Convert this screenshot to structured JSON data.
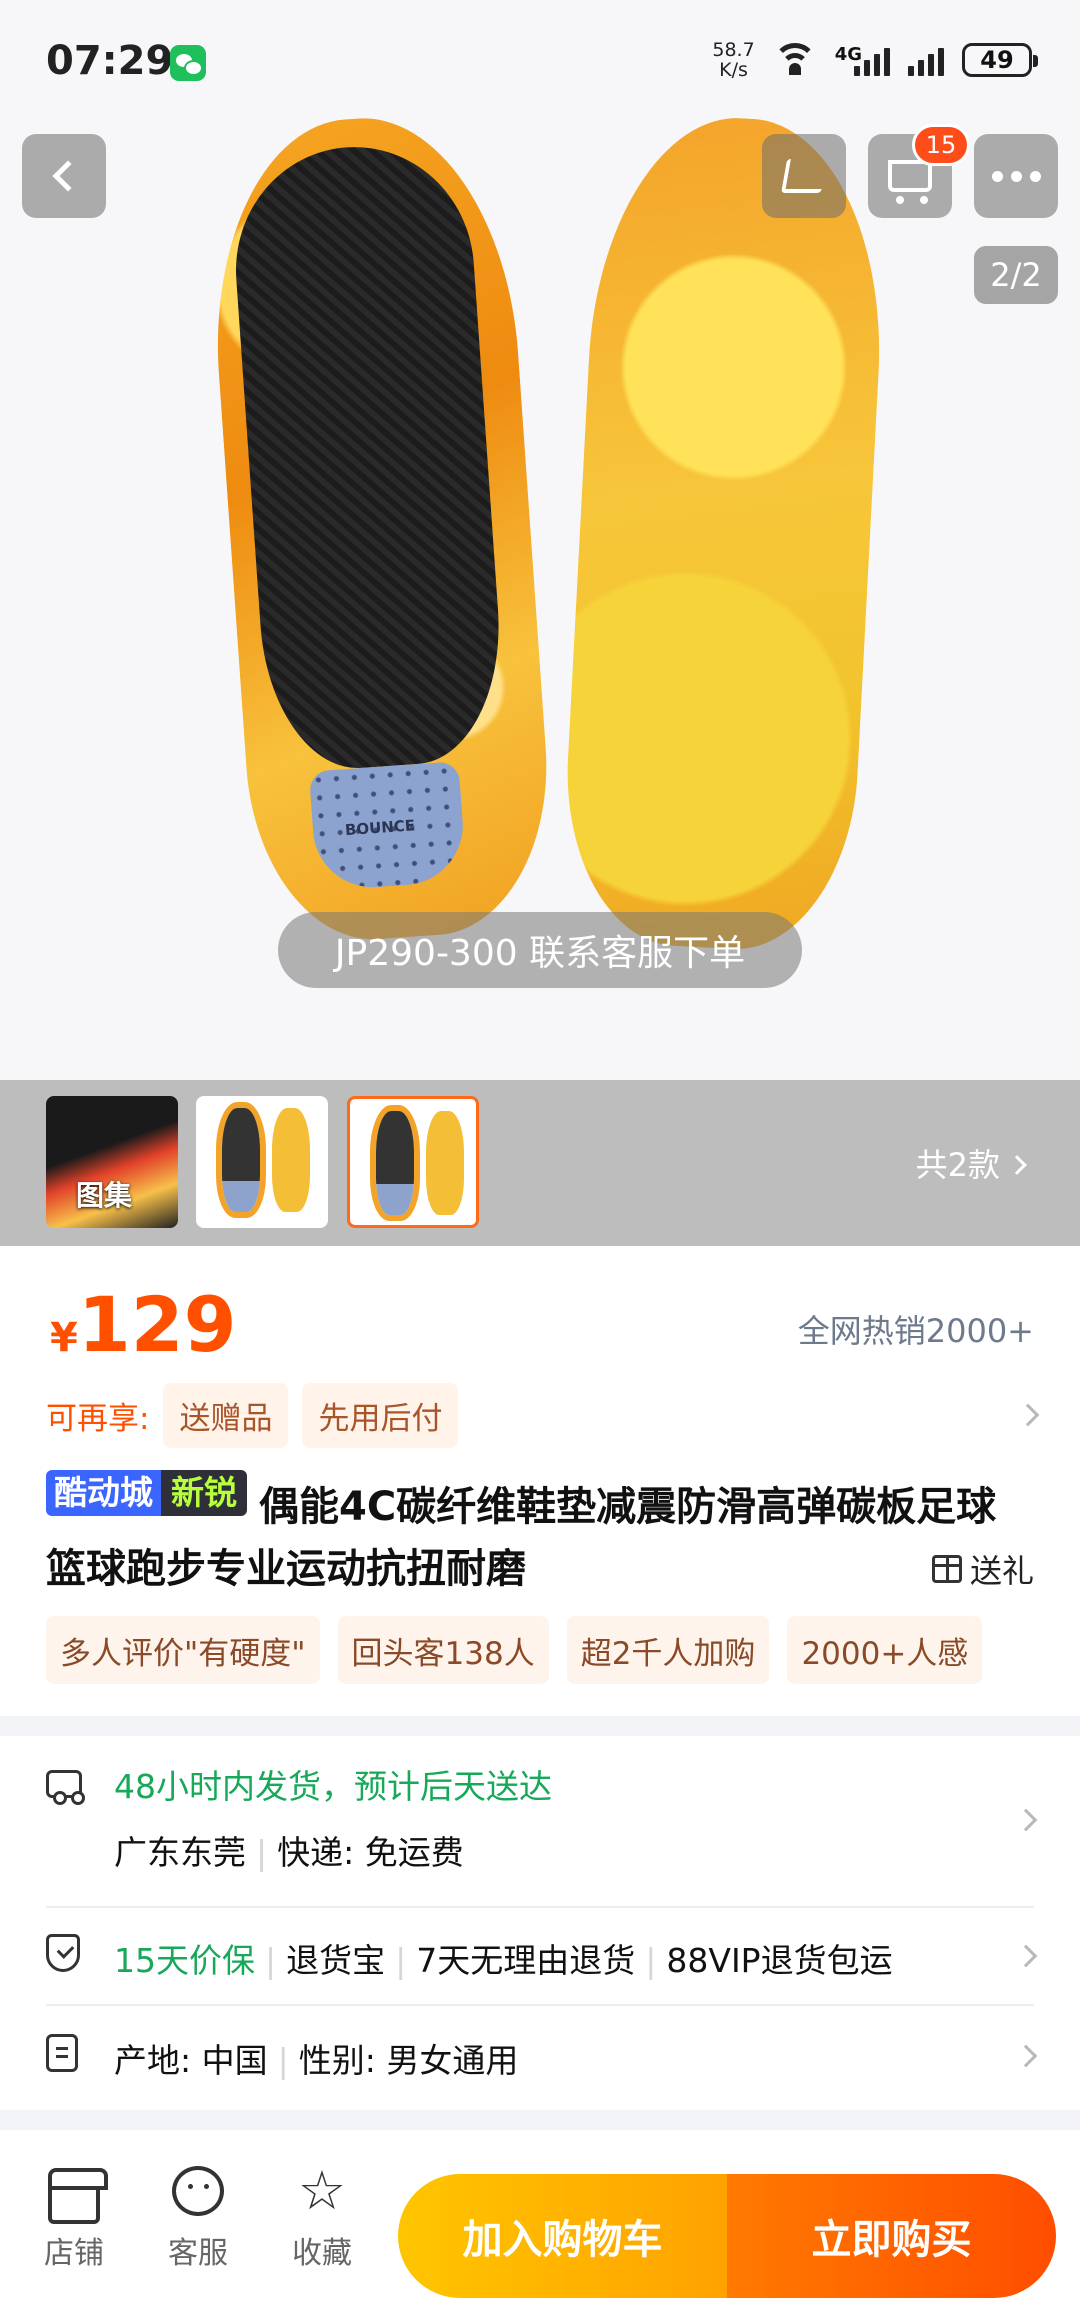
{
  "status_bar": {
    "time": "07:29",
    "net_speed_value": "58.7",
    "net_speed_unit": "K/s",
    "network": "4G",
    "battery": "49"
  },
  "header": {
    "cart_badge": "15",
    "page_counter": "2/2"
  },
  "hero": {
    "caption": "JP290-300 联系客服下单",
    "bounce_logo": "BOUNCE"
  },
  "thumbnails": {
    "gallery_label": "图集",
    "total_styles": "共2款"
  },
  "price": {
    "currency": "¥",
    "amount": "129",
    "hot_sales": "全网热销2000+"
  },
  "perks": {
    "label": "可再享:",
    "tags": [
      "送赠品",
      "先用后付"
    ]
  },
  "product": {
    "brand_tag_1": "酷动城",
    "brand_tag_2": "新锐",
    "title": "偶能4C碳纤维鞋垫减震防滑高弹碳板足球篮球跑步专业运动抗扭耐磨",
    "gift_label": "送礼"
  },
  "highlights": [
    "多人评价\"有硬度\"",
    "回头客138人",
    "超2千人加购",
    "2000+人感"
  ],
  "shipping": {
    "promise": "48小时内发货，预计后天送达",
    "origin": "广东东莞",
    "courier": "快递: 免运费"
  },
  "guarantee": {
    "price_protect": "15天价保",
    "items": [
      "退货宝",
      "7天无理由退货",
      "88VIP退货包运"
    ]
  },
  "params": {
    "origin": "产地: 中国",
    "gender": "性别: 男女通用"
  },
  "bottom_bar": {
    "shop": "店铺",
    "service": "客服",
    "favorite": "收藏",
    "add_to_cart": "加入购物车",
    "buy_now": "立即购买"
  },
  "colors": {
    "accent": "#ff5000",
    "green": "#17a85a",
    "cart_button": "#ffb000",
    "buy_button": "#ff5a00"
  }
}
